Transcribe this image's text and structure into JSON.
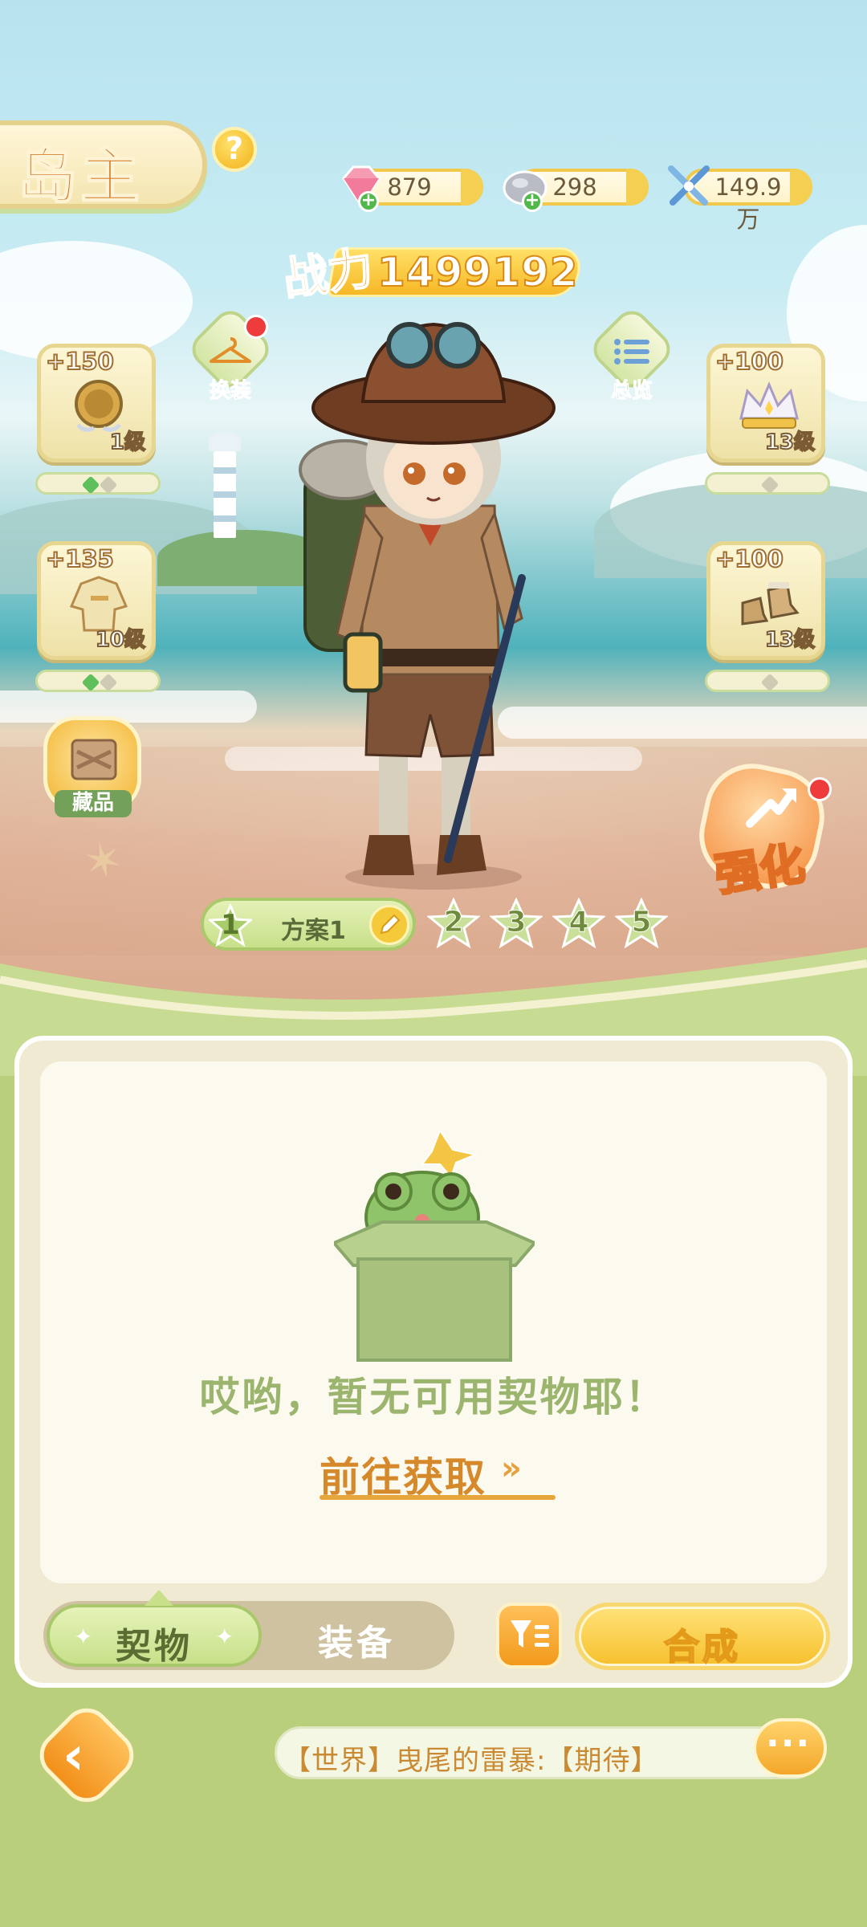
{
  "header": {
    "title": "岛主",
    "help": "?",
    "resources": [
      {
        "icon": "pink-gem-icon",
        "value": "879"
      },
      {
        "icon": "silver-ore-icon",
        "value": "298"
      },
      {
        "icon": "crossed-swords-icon",
        "value": "149.9万"
      }
    ],
    "power_label": "战力",
    "power_value": "1499192"
  },
  "slots": [
    {
      "bonus": "+150",
      "level": "1级",
      "icon": "medal-icon"
    },
    {
      "bonus": "+135",
      "level": "10级",
      "icon": "clothing-icon"
    },
    {
      "bonus": "+100",
      "level": "13级",
      "icon": "crown-icon"
    },
    {
      "bonus": "+100",
      "level": "13级",
      "icon": "boots-icon"
    }
  ],
  "buttons": {
    "outfit": "换装",
    "overview": "总览",
    "collection": "藏品",
    "enhance": "强化"
  },
  "plans": {
    "active_number": "1",
    "active_name": "方案1",
    "others": [
      "2",
      "3",
      "4",
      "5"
    ]
  },
  "panel": {
    "empty_message": "哎哟，暂无可用契物耶！",
    "goto_link": "前往获取",
    "goto_arrows": "»",
    "tabs": [
      "契物",
      "装备"
    ],
    "compose": "合成"
  },
  "footer": {
    "chat_message": "【世界】曳尾的雷暴:【期待】",
    "chat_icon": "speech-bubble-icon"
  },
  "colors": {
    "accent_orange": "#f29a1b",
    "accent_green": "#a8c86b",
    "text_brown": "#6b5a3a"
  }
}
